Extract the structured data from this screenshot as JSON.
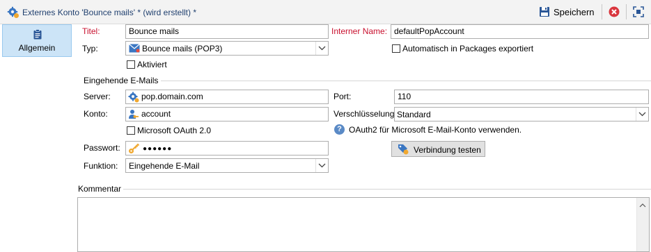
{
  "window": {
    "title": "Externes Konto 'Bounce mails' * (wird erstellt) *"
  },
  "toolbar": {
    "save_label": "Speichern"
  },
  "nav": {
    "items": [
      {
        "label": "Allgemein",
        "selected": true
      }
    ]
  },
  "form": {
    "title_label": "Titel:",
    "title_value": "Bounce mails",
    "internal_name_label": "Interner Name:",
    "internal_name_value": "defaultPopAccount",
    "type_label": "Typ:",
    "type_value": "Bounce mails (POP3)",
    "auto_export_label": "Automatisch in Packages exportiert",
    "auto_export_checked": false,
    "active_label": "Aktiviert",
    "active_checked": false
  },
  "incoming": {
    "group_label": "Eingehende E-Mails",
    "server_label": "Server:",
    "server_value": "pop.domain.com",
    "port_label": "Port:",
    "port_value": "110",
    "account_label": "Konto:",
    "account_value": "account",
    "encryption_label": "Verschlüsselung:",
    "encryption_value": "Standard",
    "oauth_label": "Microsoft OAuth 2.0",
    "oauth_checked": false,
    "oauth_hint": "OAuth2 für Microsoft E-Mail-Konto verwenden.",
    "password_label": "Passwort:",
    "password_value": "●●●●●●",
    "test_button_label": "Verbindung testen",
    "function_label": "Funktion:",
    "function_value": "Eingehende E-Mail"
  },
  "comment": {
    "label": "Kommentar",
    "value": ""
  },
  "colors": {
    "accent": "#1f3f6e",
    "required_label": "#c8102e",
    "nav_selected": "#cce4f7",
    "close_red": "#d9363e"
  }
}
